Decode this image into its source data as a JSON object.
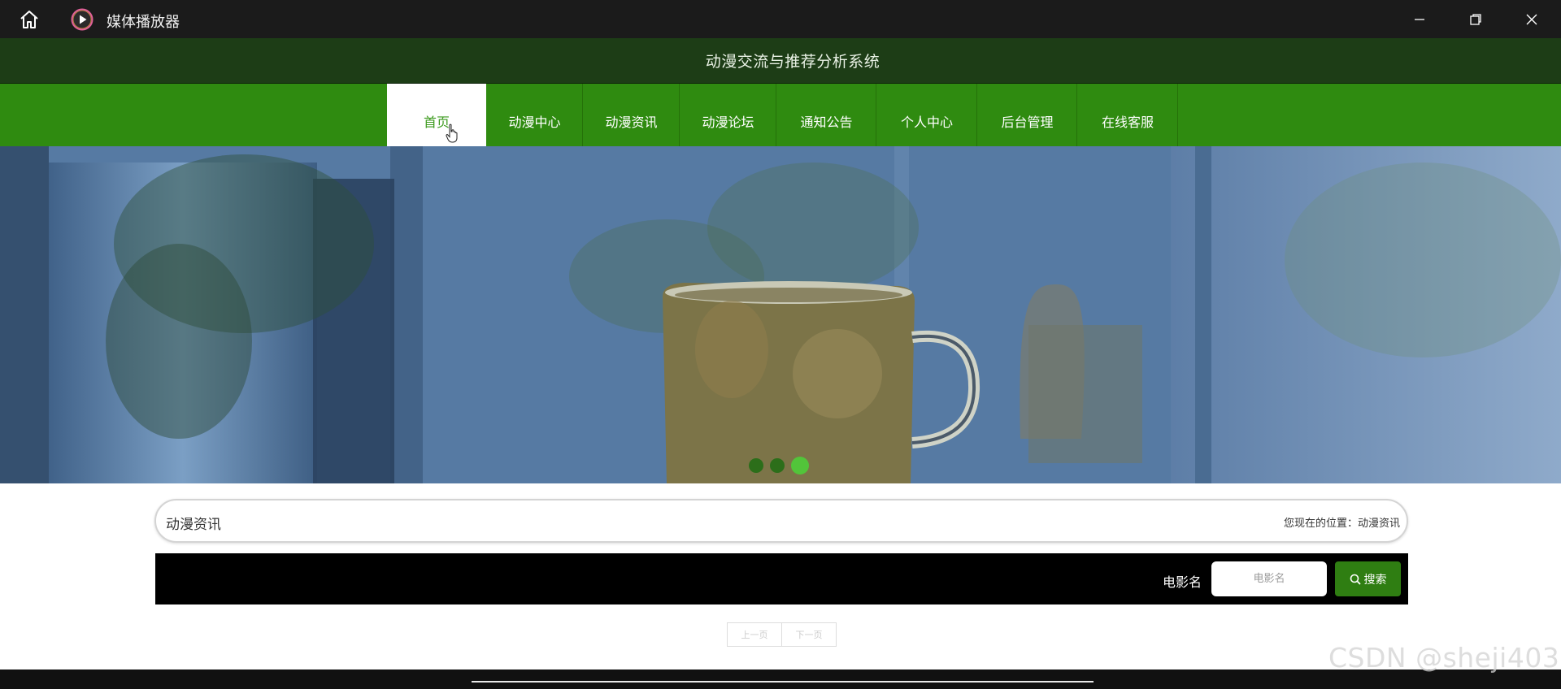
{
  "window": {
    "title": "媒体播放器"
  },
  "site": {
    "title": "动漫交流与推荐分析系统"
  },
  "nav": {
    "items": [
      {
        "label": "首页",
        "active": true
      },
      {
        "label": "动漫中心"
      },
      {
        "label": "动漫资讯"
      },
      {
        "label": "动漫论坛"
      },
      {
        "label": "通知公告"
      },
      {
        "label": "个人中心"
      },
      {
        "label": "后台管理"
      },
      {
        "label": "在线客服"
      }
    ]
  },
  "banner": {
    "slide_count": 3,
    "active_slide": 3
  },
  "breadcrumb": {
    "title": "动漫资讯",
    "location": "您现在的位置：动漫资讯"
  },
  "search": {
    "label": "电影名",
    "placeholder": "电影名",
    "button_label": "搜索"
  },
  "pager": {
    "prev": "上一页",
    "next": "下一页"
  },
  "watermark": "CSDN @sheji403",
  "colors": {
    "titlebar": "#1b1b1b",
    "header": "#1d3d16",
    "nav": "#2f8b10",
    "accent": "#3b9a1c"
  }
}
